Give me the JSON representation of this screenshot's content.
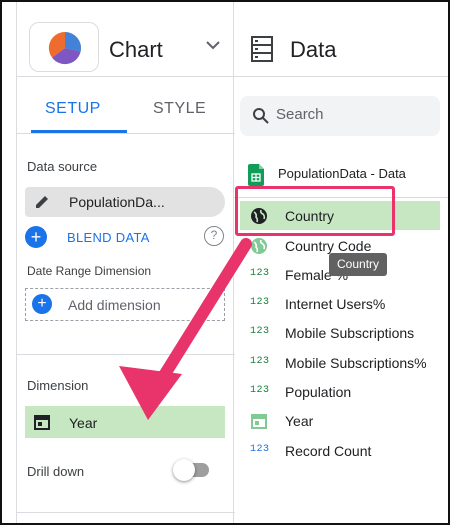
{
  "chart_panel": {
    "title": "Chart",
    "tabs": [
      {
        "label": "SETUP",
        "active": true
      },
      {
        "label": "STYLE",
        "active": false
      }
    ],
    "data_source_label": "Data source",
    "data_source_value": "PopulationDa...",
    "blend_label": "BLEND DATA",
    "date_range_label": "Date Range Dimension",
    "add_dimension_label": "Add dimension",
    "dimension_label": "Dimension",
    "dimension_value": "Year",
    "drill_down_label": "Drill down",
    "drill_down_enabled": false
  },
  "data_panel": {
    "title": "Data",
    "search_placeholder": "Search",
    "source_name": "PopulationData - Data",
    "fields": [
      {
        "label": "Country",
        "type_icon": "globe-icon",
        "selected": true
      },
      {
        "label": "Country Code",
        "type_icon": "globe-icon",
        "selected": false
      },
      {
        "label": "Female %",
        "type_icon": "123",
        "selected": false
      },
      {
        "label": "Internet Users%",
        "type_icon": "123",
        "selected": false
      },
      {
        "label": "Mobile Subscriptions",
        "type_icon": "123",
        "selected": false
      },
      {
        "label": "Mobile Subscriptions%",
        "type_icon": "123",
        "selected": false
      },
      {
        "label": "Population",
        "type_icon": "123",
        "selected": false
      },
      {
        "label": "Year",
        "type_icon": "calendar-icon",
        "selected": false
      },
      {
        "label": "Record Count",
        "type_icon": "123",
        "selected": false
      }
    ],
    "tooltip": "Country"
  },
  "colors": {
    "accent_blue": "#1a73e8",
    "selected_green": "#c6e7c1",
    "annotation_pink": "#e8336b"
  }
}
